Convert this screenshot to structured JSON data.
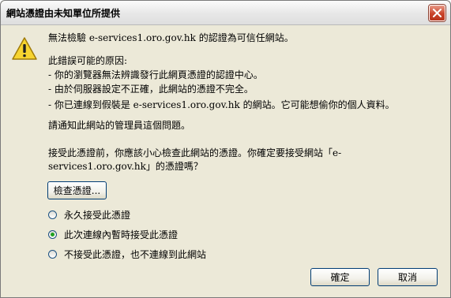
{
  "dialog": {
    "title": "網站憑證由未知單位所提供"
  },
  "message": {
    "cannot_verify": "無法檢驗 e-services1.oro.gov.hk 的認證為可信任網站。",
    "possible_causes_heading": "此錯誤可能的原因:",
    "cause_1": "- 你的瀏覽器無法辨識發行此網頁憑證的認證中心。",
    "cause_2": "- 由於伺服器設定不正確，此網站的憑證不完全。",
    "cause_3": "- 你已連線到假裝是 e-services1.oro.gov.hk 的網站。它可能想偷你的個人資料。",
    "notify_admin": "請通知此網站的管理員這個問題。",
    "confirm_question": "接受此憑證前，你應該小心檢查此網站的憑證。你確定要接受網站「e-services1.oro.gov.hk」的憑證嗎？"
  },
  "buttons": {
    "examine": "檢查憑證...",
    "ok": "確定",
    "cancel": "取消"
  },
  "options": [
    {
      "label": "永久接受此憑證",
      "selected": false
    },
    {
      "label": "此次連線內暫時接受此憑證",
      "selected": true
    },
    {
      "label": "不接受此憑證，也不連線到此網站",
      "selected": false
    }
  ],
  "icons": {
    "warning": "warning-icon",
    "close": "close-icon"
  }
}
